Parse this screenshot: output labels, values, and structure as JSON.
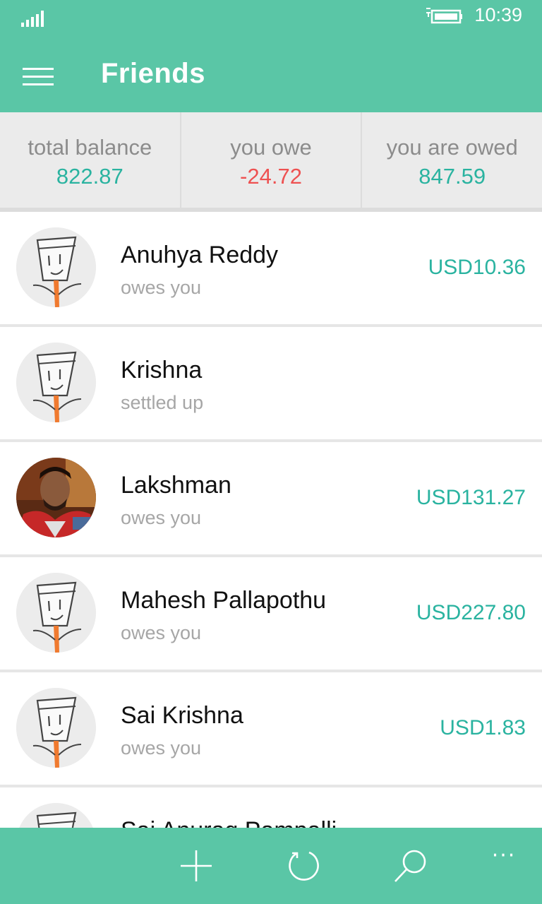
{
  "status_bar": {
    "time": "10:39",
    "icons": [
      "signal-icon",
      "battery-charging-icon"
    ]
  },
  "header": {
    "title": "Friends",
    "menu_icon": "hamburger-icon"
  },
  "summary": {
    "total_balance": {
      "label": "total balance",
      "value": "822.87"
    },
    "you_owe": {
      "label": "you owe",
      "value": "-24.72"
    },
    "you_are_owed": {
      "label": "you are owed",
      "value": "847.59"
    }
  },
  "friends": [
    {
      "name": "Anuhya Reddy",
      "status": "owes you",
      "amount": "USD10.36",
      "avatar": "default-avatar"
    },
    {
      "name": "Krishna",
      "status": "settled up",
      "amount": "",
      "avatar": "default-avatar"
    },
    {
      "name": "Lakshman",
      "status": "owes you",
      "amount": "USD131.27",
      "avatar": "photo-avatar"
    },
    {
      "name": "Mahesh Pallapothu",
      "status": "owes you",
      "amount": "USD227.80",
      "avatar": "default-avatar"
    },
    {
      "name": "Sai Krishna",
      "status": "owes you",
      "amount": "USD1.83",
      "avatar": "default-avatar"
    },
    {
      "name": "Sai Anurag Pampalli",
      "status": "",
      "amount": "",
      "avatar": "default-avatar"
    }
  ],
  "app_bar": {
    "buttons": [
      "add-icon",
      "refresh-icon",
      "search-icon",
      "more-icon"
    ],
    "more_label": "···"
  },
  "colors": {
    "brand": "#5ac6a6",
    "positive": "#2ab3a0",
    "negative": "#ee5151",
    "summary_bg": "#ebebeb"
  }
}
